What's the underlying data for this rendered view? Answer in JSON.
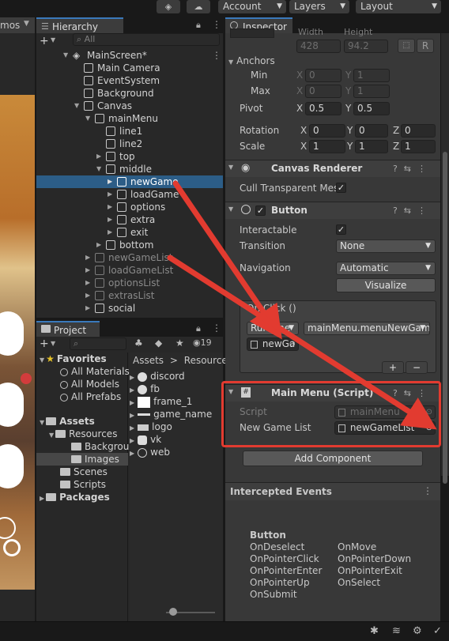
{
  "topbar": {
    "account": "Account",
    "layers": "Layers",
    "layout": "Layout"
  },
  "scene": {
    "tab_fragment": "mos"
  },
  "hierarchy": {
    "tab": "Hierarchy",
    "search_placeholder": "All",
    "items": [
      {
        "label": "MainScreen*"
      },
      {
        "label": "Main Camera"
      },
      {
        "label": "EventSystem"
      },
      {
        "label": "Background"
      },
      {
        "label": "Canvas"
      },
      {
        "label": "mainMenu"
      },
      {
        "label": "line1"
      },
      {
        "label": "line2"
      },
      {
        "label": "top"
      },
      {
        "label": "middle"
      },
      {
        "label": "newGame"
      },
      {
        "label": "loadGame"
      },
      {
        "label": "options"
      },
      {
        "label": "extra"
      },
      {
        "label": "exit"
      },
      {
        "label": "bottom"
      },
      {
        "label": "newGameList"
      },
      {
        "label": "loadGameList"
      },
      {
        "label": "optionsList"
      },
      {
        "label": "extrasList"
      },
      {
        "label": "social"
      }
    ]
  },
  "project": {
    "tab": "Project",
    "hidden_count": "19",
    "favorites": "Favorites",
    "fav_items": [
      "All Materials",
      "All Models",
      "All Prefabs"
    ],
    "assets": "Assets",
    "resources": "Resources",
    "res_children": [
      "Backgrou",
      "Images"
    ],
    "scenes": "Scenes",
    "scripts": "Scripts",
    "packages": "Packages",
    "breadcrumb": [
      "Assets",
      "Resources"
    ],
    "files": [
      "discord",
      "fb",
      "frame_1",
      "game_name",
      "logo",
      "vk",
      "web"
    ]
  },
  "inspector": {
    "tab": "Inspector",
    "width_label": "Width",
    "height_label": "Height",
    "width_value": "428",
    "height_value": "94.2",
    "r_button": "R",
    "anchors": "Anchors",
    "min": "Min",
    "max": "Max",
    "min_x": "0",
    "min_y": "1",
    "max_x": "0",
    "max_y": "1",
    "pivot": "Pivot",
    "pivot_x": "0.5",
    "pivot_y": "0.5",
    "rotation": "Rotation",
    "rot_x": "0",
    "rot_y": "0",
    "rot_z": "0",
    "scale": "Scale",
    "scale_x": "1",
    "scale_y": "1",
    "scale_z": "1",
    "x": "X",
    "y": "Y",
    "z": "Z",
    "canvas_renderer": "Canvas Renderer",
    "cull_transparent": "Cull Transparent Mes",
    "button": "Button",
    "interactable": "Interactable",
    "transition": "Transition",
    "transition_value": "None",
    "navigation": "Navigation",
    "navigation_value": "Automatic",
    "visualize": "Visualize",
    "on_click": "On Click ()",
    "runtime": "Runtime",
    "function": "mainMenu.menuNewGam",
    "target_object": "newGa",
    "add": "+",
    "remove": "−",
    "main_menu_script": "Main Menu (Script)",
    "script_label": "Script",
    "script_value": "mainMenu",
    "new_game_list_label": "New Game List",
    "new_game_list_value": "newGameList",
    "add_component": "Add Component",
    "intercepted_events": "Intercepted Events",
    "events_title": "Button",
    "events_left": [
      "OnDeselect",
      "OnPointerClick",
      "OnPointerEnter",
      "OnPointerUp",
      "OnSubmit"
    ],
    "events_right": [
      "OnMove",
      "OnPointerDown",
      "OnPointerExit",
      "OnSelect"
    ]
  },
  "colors": {
    "selection": "#2c5d87",
    "accent": "#3a79bb",
    "annotation_red": "#e23b30"
  }
}
